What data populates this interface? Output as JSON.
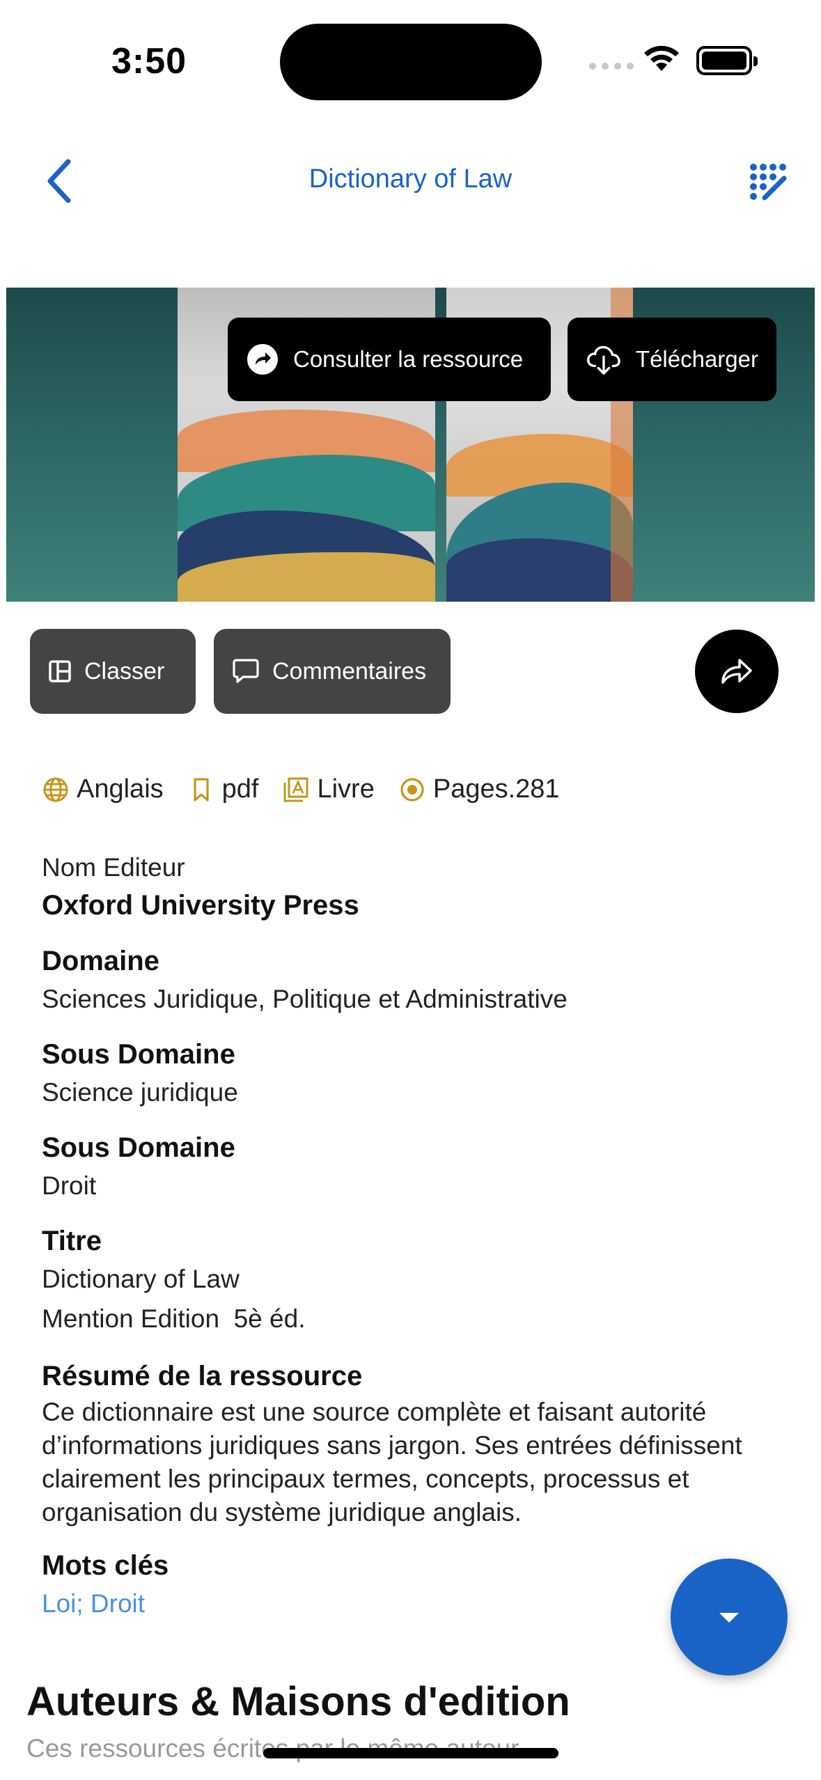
{
  "status_bar": {
    "time": "3:50"
  },
  "nav": {
    "title": "Dictionary of Law",
    "back_icon": "chevron-left-icon",
    "action_icon": "magic-edit-icon"
  },
  "hero": {
    "consult_label": "Consulter la ressource",
    "download_label": "Télécharger"
  },
  "actions": {
    "classer_label": "Classer",
    "comments_label": "Commentaires"
  },
  "meta": {
    "language": "Anglais",
    "format": "pdf",
    "type": "Livre",
    "pages": "Pages.281"
  },
  "details": {
    "publisher_label": "Nom Editeur",
    "publisher_value": "Oxford University Press",
    "domain_label": "Domaine",
    "domain_value": "Sciences Juridique, Politique et Administrative",
    "subdomain1_label": "Sous Domaine",
    "subdomain1_value": "Science juridique",
    "subdomain2_label": "Sous Domaine",
    "subdomain2_value": "Droit",
    "title_label": "Titre",
    "title_value": "Dictionary of Law",
    "mention_label": "Mention Edition",
    "mention_value": "5è éd.",
    "summary_label": "Résumé de la ressource",
    "summary_value": "Ce dictionnaire est une source complète et faisant autorité d’informations juridiques sans jargon. Ses entrées définissent clairement les principaux termes, concepts, processus et organisation du système juridique anglais.",
    "keywords_label": "Mots clés",
    "keywords_value": "Loi; Droit"
  },
  "authors": {
    "title": "Auteurs & Maisons d'edition",
    "subtitle": "Ces ressources écrites par le même auteur"
  },
  "colors": {
    "accent": "#1a63c6",
    "icon_gold": "#c4961a",
    "link": "#4a90e2",
    "pill": "#444444"
  }
}
